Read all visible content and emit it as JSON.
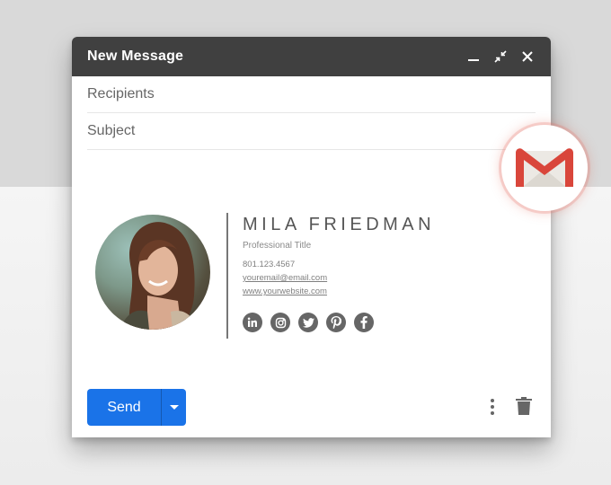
{
  "window": {
    "title": "New Message"
  },
  "fields": {
    "recipients_placeholder": "Recipients",
    "subject_placeholder": "Subject"
  },
  "signature": {
    "name": "MILA FRIEDMAN",
    "title": "Professional Title",
    "phone": "801.123.4567",
    "email": "youremail@email.com",
    "website": "www.yourwebsite.com",
    "socials": [
      "linkedin-icon",
      "instagram-icon",
      "twitter-icon",
      "pinterest-icon",
      "facebook-icon"
    ]
  },
  "footer": {
    "send_label": "Send"
  },
  "colors": {
    "titlebar": "#404040",
    "send": "#1a73e8",
    "gmail_red": "#d93025"
  }
}
